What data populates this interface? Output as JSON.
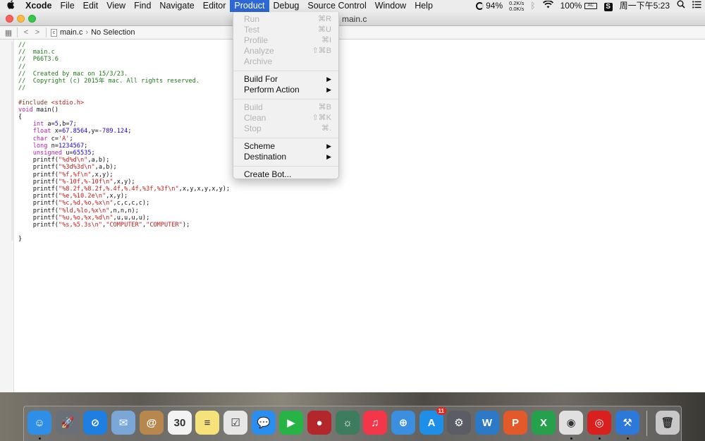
{
  "menubar": {
    "app_name": "Xcode",
    "items": [
      "File",
      "Edit",
      "View",
      "Find",
      "Navigate",
      "Editor",
      "Product",
      "Debug",
      "Source Control",
      "Window",
      "Help"
    ],
    "active_item": "Product",
    "status": {
      "battery_circle": "94%",
      "net_up": "0.2K/s",
      "net_down": "0.0K/s",
      "battery": "100%",
      "battery_icon_text": "AC",
      "sogou": "S",
      "datetime": "周一下午5:23"
    }
  },
  "window": {
    "title": "main.c",
    "file_icon_letter": "c",
    "jumpbar": {
      "file": "main.c",
      "selection": "No Selection"
    }
  },
  "code": {
    "lines": [
      "//",
      "//  main.c",
      "//  P66T3.6",
      "//",
      "//  Created by mac on 15/3/23.",
      "//  Copyright (c) 2015年 mac. All rights reserved.",
      "//",
      "",
      "#include <stdio.h>",
      "void main()",
      "{",
      "    int a=5,b=7;",
      "    float x=67.8564,y=-789.124;",
      "    char c='A';",
      "    long n=1234567;",
      "    unsigned u=65535;",
      "    printf(\"%d%d\\n\",a,b);",
      "    printf(\"%3d%3d\\n\",a,b);",
      "    printf(\"%f,%f\\n\",x,y);",
      "    printf(\"%-10f,%-10f\\n\",x,y);",
      "    printf(\"%8.2f,%8.2f,%.4f,%.4f,%3f,%3f\\n\",x,y,x,y,x,y);",
      "    printf(\"%e,%10.2e\\n\",x,y);",
      "    printf(\"%c,%d,%o,%x\\n\",c,c,c,c);",
      "    printf(\"%ld,%lo,%x\\n\",n,n,n);",
      "    printf(\"%u,%o,%x,%d\\n\",u,u,u,u);",
      "    printf(\"%s,%5.3s\\n\",\"COMPUTER\",\"COMPUTER\");",
      "",
      "}"
    ]
  },
  "product_menu": {
    "groups": [
      [
        {
          "label": "Run",
          "shortcut": "⌘R",
          "enabled": false
        },
        {
          "label": "Test",
          "shortcut": "⌘U",
          "enabled": false
        },
        {
          "label": "Profile",
          "shortcut": "⌘I",
          "enabled": false
        },
        {
          "label": "Analyze",
          "shortcut": "⇧⌘B",
          "enabled": false
        },
        {
          "label": "Archive",
          "shortcut": "",
          "enabled": false
        }
      ],
      [
        {
          "label": "Build For",
          "submenu": true,
          "enabled": true
        },
        {
          "label": "Perform Action",
          "submenu": true,
          "enabled": true
        }
      ],
      [
        {
          "label": "Build",
          "shortcut": "⌘B",
          "enabled": false
        },
        {
          "label": "Clean",
          "shortcut": "⇧⌘K",
          "enabled": false
        },
        {
          "label": "Stop",
          "shortcut": "⌘.",
          "enabled": false
        }
      ],
      [
        {
          "label": "Scheme",
          "submenu": true,
          "enabled": true
        },
        {
          "label": "Destination",
          "submenu": true,
          "enabled": true
        }
      ],
      [
        {
          "label": "Create Bot...",
          "shortcut": "",
          "enabled": true
        }
      ]
    ]
  },
  "dock": {
    "apps": [
      {
        "name": "finder-icon",
        "glyph": "☺",
        "color": "#2f8ee6",
        "running": true
      },
      {
        "name": "launchpad-icon",
        "glyph": "🚀",
        "color": "#6b6f78",
        "running": false
      },
      {
        "name": "safari-icon",
        "glyph": "⊘",
        "color": "#1f7fe0",
        "running": false
      },
      {
        "name": "mail-icon",
        "glyph": "✉",
        "color": "#7aa7d8",
        "running": false
      },
      {
        "name": "contacts-icon",
        "glyph": "@",
        "color": "#b8874d",
        "running": false
      },
      {
        "name": "calendar-icon",
        "glyph": "30",
        "color": "#f3f3f3",
        "running": false
      },
      {
        "name": "notes-icon",
        "glyph": "≡",
        "color": "#f5e27a",
        "running": false
      },
      {
        "name": "reminders-icon",
        "glyph": "☑",
        "color": "#e6e6e6",
        "running": false
      },
      {
        "name": "messages-icon",
        "glyph": "💬",
        "color": "#2a8df0",
        "running": false
      },
      {
        "name": "facetime-icon",
        "glyph": "▶",
        "color": "#27b446",
        "running": false
      },
      {
        "name": "photo-booth-icon",
        "glyph": "●",
        "color": "#b3262b",
        "running": false
      },
      {
        "name": "iphoto-icon",
        "glyph": "☼",
        "color": "#3d7c5c",
        "running": false
      },
      {
        "name": "itunes-icon",
        "glyph": "♫",
        "color": "#f3364a",
        "running": false
      },
      {
        "name": "ibooks-icon",
        "glyph": "⊕",
        "color": "#3b8fe0",
        "running": false
      },
      {
        "name": "app-store-icon",
        "glyph": "A",
        "color": "#1e8fe9",
        "running": false,
        "badge": "11"
      },
      {
        "name": "system-preferences-icon",
        "glyph": "⚙",
        "color": "#5a5e64",
        "running": false
      },
      {
        "name": "word-icon",
        "glyph": "W",
        "color": "#2b79c7",
        "running": false
      },
      {
        "name": "powerpoint-icon",
        "glyph": "P",
        "color": "#e25a2a",
        "running": false
      },
      {
        "name": "excel-icon",
        "glyph": "X",
        "color": "#26a14b",
        "running": false
      },
      {
        "name": "chrome-icon",
        "glyph": "◉",
        "color": "#e0e0e0",
        "running": true
      },
      {
        "name": "netease-music-icon",
        "glyph": "◎",
        "color": "#d9201e",
        "running": true
      },
      {
        "name": "xcode-icon",
        "glyph": "⚒",
        "color": "#2d79d9",
        "running": true
      },
      {
        "name": "trash-icon",
        "glyph": "🗑",
        "color": "#c8c8c8",
        "running": false
      }
    ]
  }
}
